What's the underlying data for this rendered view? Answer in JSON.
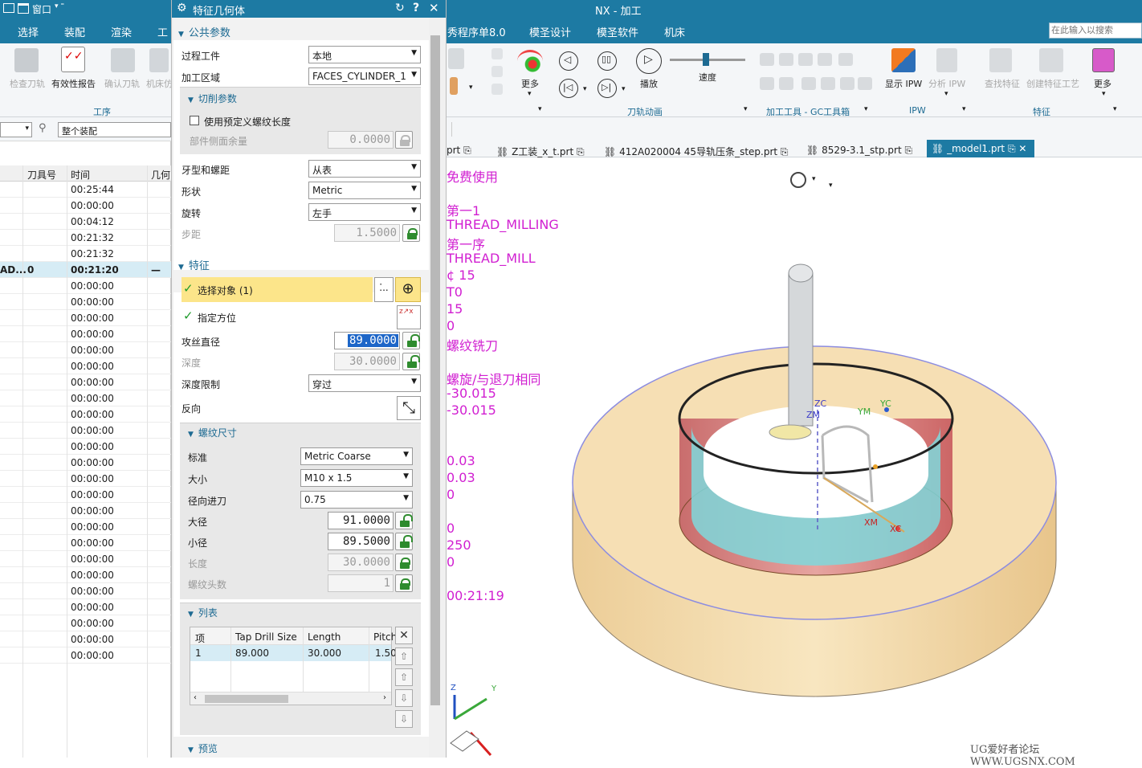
{
  "top": {
    "window_menu": "窗口",
    "app_title": "NX - 加工"
  },
  "menu": {
    "left": [
      "选择",
      "装配",
      "渲染",
      "工"
    ],
    "right": [
      "秀程序单8.0",
      "模圣设计",
      "模圣软件",
      "机床"
    ],
    "search_placeholder": "在此输入以搜索"
  },
  "ribbon": {
    "left_buttons": [
      "检查刀轨",
      "有效性报告",
      "确认刀轨",
      "机床仿"
    ],
    "left_group": "工序",
    "more1": "更多",
    "play": "播放",
    "speed": "速度",
    "speed_level": 0.45,
    "anim_group": "刀轨动画",
    "tools_group": "加工工具 - GC工具箱",
    "show_ipw": "显示 IPW",
    "analyze_ipw": "分析 IPW",
    "ipw_group": "IPW",
    "find_feature": "查找特征",
    "create_feature_process": "创建特征工艺",
    "more2": "更多",
    "feature_group": "特征"
  },
  "filter": {
    "assembly": "整个装配"
  },
  "navigator": {
    "columns": [
      "刀具号",
      "时间",
      "几何"
    ],
    "rows": [
      {
        "name": "",
        "tool": "",
        "time": "00:25:44",
        "geom": ""
      },
      {
        "name": "",
        "tool": "",
        "time": "00:00:00",
        "geom": ""
      },
      {
        "name": "",
        "tool": "",
        "time": "00:04:12",
        "geom": ""
      },
      {
        "name": "",
        "tool": "",
        "time": "00:21:32",
        "geom": ""
      },
      {
        "name": "",
        "tool": "",
        "time": "00:21:32",
        "geom": ""
      },
      {
        "name": "AD...",
        "tool": "0",
        "time": "00:21:20",
        "geom": "—"
      },
      {
        "name": "",
        "tool": "",
        "time": "00:00:00",
        "geom": ""
      },
      {
        "name": "",
        "tool": "",
        "time": "00:00:00",
        "geom": ""
      },
      {
        "name": "",
        "tool": "",
        "time": "00:00:00",
        "geom": ""
      },
      {
        "name": "",
        "tool": "",
        "time": "00:00:00",
        "geom": ""
      },
      {
        "name": "",
        "tool": "",
        "time": "00:00:00",
        "geom": ""
      },
      {
        "name": "",
        "tool": "",
        "time": "00:00:00",
        "geom": ""
      },
      {
        "name": "",
        "tool": "",
        "time": "00:00:00",
        "geom": ""
      },
      {
        "name": "",
        "tool": "",
        "time": "00:00:00",
        "geom": ""
      },
      {
        "name": "",
        "tool": "",
        "time": "00:00:00",
        "geom": ""
      },
      {
        "name": "",
        "tool": "",
        "time": "00:00:00",
        "geom": ""
      },
      {
        "name": "",
        "tool": "",
        "time": "00:00:00",
        "geom": ""
      },
      {
        "name": "",
        "tool": "",
        "time": "00:00:00",
        "geom": ""
      },
      {
        "name": "",
        "tool": "",
        "time": "00:00:00",
        "geom": ""
      },
      {
        "name": "",
        "tool": "",
        "time": "00:00:00",
        "geom": ""
      },
      {
        "name": "",
        "tool": "",
        "time": "00:00:00",
        "geom": ""
      },
      {
        "name": "",
        "tool": "",
        "time": "00:00:00",
        "geom": ""
      },
      {
        "name": "",
        "tool": "",
        "time": "00:00:00",
        "geom": ""
      },
      {
        "name": "",
        "tool": "",
        "time": "00:00:00",
        "geom": ""
      },
      {
        "name": "",
        "tool": "",
        "time": "00:00:00",
        "geom": ""
      },
      {
        "name": "",
        "tool": "",
        "time": "00:00:00",
        "geom": ""
      },
      {
        "name": "",
        "tool": "",
        "time": "00:00:00",
        "geom": ""
      },
      {
        "name": "",
        "tool": "",
        "time": "00:00:00",
        "geom": ""
      },
      {
        "name": "",
        "tool": "",
        "time": "00:00:00",
        "geom": ""
      },
      {
        "name": "",
        "tool": "",
        "time": "00:00:00",
        "geom": ""
      }
    ]
  },
  "dialog": {
    "title": "特征几何体",
    "common_params": "公共参数",
    "process_workpiece_label": "过程工件",
    "process_workpiece_value": "本地",
    "machining_area_label": "加工区域",
    "machining_area_value": "FACES_CYLINDER_1",
    "cut_params": "切削参数",
    "use_predefined_thread_length": "使用预定义螺纹长度",
    "part_side_stock_label": "部件侧面余量",
    "part_side_stock_value": "0.0000",
    "thread_pitch_label": "牙型和螺距",
    "thread_pitch_value": "从表",
    "shape_label": "形状",
    "shape_value": "Metric",
    "rotation_label": "旋转",
    "rotation_value": "左手",
    "pitch_label": "步距",
    "pitch_value": "1.5000",
    "feature_section": "特征",
    "select_object": "选择对象 (1)",
    "specify_orientation": "指定方位",
    "tap_diameter_label": "攻丝直径",
    "tap_diameter_value": "89.0000",
    "depth_label": "深度",
    "depth_value": "30.0000",
    "depth_limit_label": "深度限制",
    "depth_limit_value": "穿过",
    "reverse_label": "反向",
    "thread_size_section": "螺纹尺寸",
    "standard_label": "标准",
    "standard_value": "Metric Coarse",
    "size_label": "大小",
    "size_value": "M10 x 1.5",
    "radial_feed_label": "径向进刀",
    "radial_feed_value": "0.75",
    "major_diameter_label": "大径",
    "major_diameter_value": "91.0000",
    "minor_diameter_label": "小径",
    "minor_diameter_value": "89.5000",
    "length_label": "长度",
    "length_value": "30.0000",
    "thread_starts_label": "螺纹头数",
    "thread_starts_value": "1",
    "list_section": "列表",
    "list_columns": [
      "项",
      "Tap Drill Size",
      "Length",
      "Pitch"
    ],
    "list_row": [
      "1",
      "89.000",
      "30.000",
      "1.50"
    ],
    "preview_section": "预览"
  },
  "tabs": [
    "prt",
    "Z工装_x_t.prt",
    "412A020004 45导轨压条_step.prt",
    "8529-3.1_stp.prt",
    "_model1.prt"
  ],
  "viewport": {
    "info_lines": [
      "免费使用",
      "",
      "第一1",
      "THREAD_MILLING",
      "第一序",
      "THREAD_MILL",
      "¢ 15",
      "T0",
      "15",
      "0",
      "螺纹铣刀",
      "",
      "螺旋/与退刀相同",
      "-30.015",
      "-30.015",
      "",
      "",
      "0.03",
      "0.03",
      "0",
      "",
      "0",
      "250",
      "0",
      "",
      "00:21:19"
    ],
    "axis_labels": {
      "zc": "ZC",
      "zm": "ZM",
      "ym": "YM",
      "yc": "YC",
      "xm": "XM",
      "xc": "XC",
      "z": "Z",
      "y": "Y"
    },
    "watermark": "UG爱好者论坛 WWW.UGSNX.COM"
  },
  "colors": {
    "accent": "#1d7aa3",
    "info_text": "#d11fd1",
    "highlight": "#fce58a",
    "part": "#f6dfb4",
    "thread": "#7fd8dc"
  }
}
